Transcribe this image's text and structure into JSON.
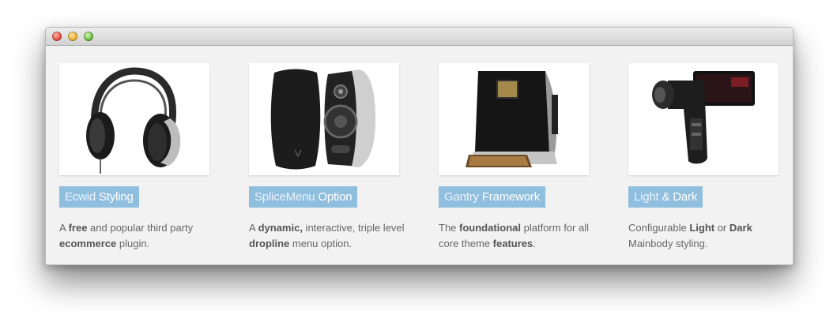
{
  "features": [
    {
      "image_icon": "headphones-icon",
      "title_a": "Ecwid",
      "title_b": "Styling",
      "desc": [
        {
          "t": "A ",
          "b": false
        },
        {
          "t": "free",
          "b": true
        },
        {
          "t": " and popular third party ",
          "b": false
        },
        {
          "t": "ecommerce",
          "b": true
        },
        {
          "t": " plugin.",
          "b": false
        }
      ]
    },
    {
      "image_icon": "speakers-icon",
      "title_a": "SpliceMenu",
      "title_b": "Option",
      "desc": [
        {
          "t": "A ",
          "b": false
        },
        {
          "t": "dynamic,",
          "b": true
        },
        {
          "t": " interactive, triple level ",
          "b": false
        },
        {
          "t": "dropline",
          "b": true
        },
        {
          "t": " menu option.",
          "b": false
        }
      ]
    },
    {
      "image_icon": "photo-printer-icon",
      "title_a": "Gantry",
      "title_b": "Framework",
      "desc": [
        {
          "t": "The ",
          "b": false
        },
        {
          "t": "foundational",
          "b": true
        },
        {
          "t": " platform for all core theme ",
          "b": false
        },
        {
          "t": "features",
          "b": true
        },
        {
          "t": ".",
          "b": false
        }
      ]
    },
    {
      "image_icon": "camcorder-icon",
      "title_a": "Light",
      "title_b": "& Dark",
      "desc": [
        {
          "t": "Configurable ",
          "b": false
        },
        {
          "t": "Light",
          "b": true
        },
        {
          "t": " or ",
          "b": false
        },
        {
          "t": "Dark",
          "b": true
        },
        {
          "t": " Mainbody styling.",
          "b": false
        }
      ]
    }
  ],
  "colors": {
    "heading_bg": "#90bedf",
    "body_text": "#666666",
    "window_bg": "#f2f2f2"
  }
}
